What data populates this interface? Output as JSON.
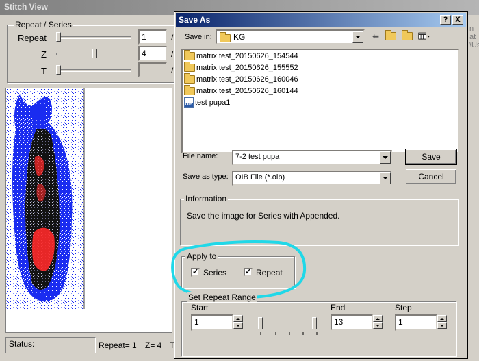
{
  "background_window": {
    "title": "Stitch View",
    "group_label": "Repeat / Series",
    "sliders": [
      {
        "label": "Repeat",
        "value": "1",
        "level": 0.0,
        "suffix": "/"
      },
      {
        "label": "Z",
        "value": "4",
        "level": 0.5,
        "suffix": "/"
      },
      {
        "label": "T",
        "value": "",
        "level": 0.0,
        "suffix": "/"
      }
    ],
    "right_edge_text": [
      "n at",
      "\\Us"
    ],
    "status": {
      "label": "Status:",
      "repeat": "Repeat= 1",
      "z": "Z= 4",
      "t": "T"
    }
  },
  "dialog": {
    "title": "Save As",
    "help_label": "?",
    "close_label": "X",
    "save_in_label": "Save in:",
    "save_in_value": "KG",
    "toolbar": {
      "back_icon": "back-arrow-icon",
      "up_icon": "up-folder-icon",
      "new_folder_icon": "new-folder-icon",
      "view_icon": "view-menu-icon"
    },
    "files": [
      {
        "name": "matrix test_20150626_154544",
        "type": "folder"
      },
      {
        "name": "matrix test_20150626_155552",
        "type": "folder"
      },
      {
        "name": "matrix test_20150626_160046",
        "type": "folder"
      },
      {
        "name": "matrix test_20150626_160144",
        "type": "folder"
      },
      {
        "name": "test pupa1",
        "type": "oib"
      }
    ],
    "oib_badge": "OIB",
    "file_name_label": "File name:",
    "file_name_value": "7-2 test pupa",
    "save_as_type_label": "Save as type:",
    "save_as_type_value": "OIB File (*.oib)",
    "save_button": "Save",
    "cancel_button": "Cancel",
    "information": {
      "label": "Information",
      "text": "Save the image for Series with Appended."
    },
    "apply_to": {
      "label": "Apply to",
      "series_label": "Series",
      "series_checked": true,
      "repeat_label": "Repeat",
      "repeat_checked": true,
      "check_mark": "✓"
    },
    "range": {
      "label": "Set Repeat Range",
      "start_label": "Start",
      "start_value": "1",
      "end_label": "End",
      "end_value": "13",
      "step_label": "Step",
      "step_value": "1"
    }
  },
  "colors": {
    "window_bg": "#d4d0c8",
    "active_title": "#0a246a",
    "inactive_title": "#808080",
    "highlight_circle": "#20d8e8",
    "image_blue": "#1a2cf0",
    "image_red": "#ff2a2a"
  }
}
